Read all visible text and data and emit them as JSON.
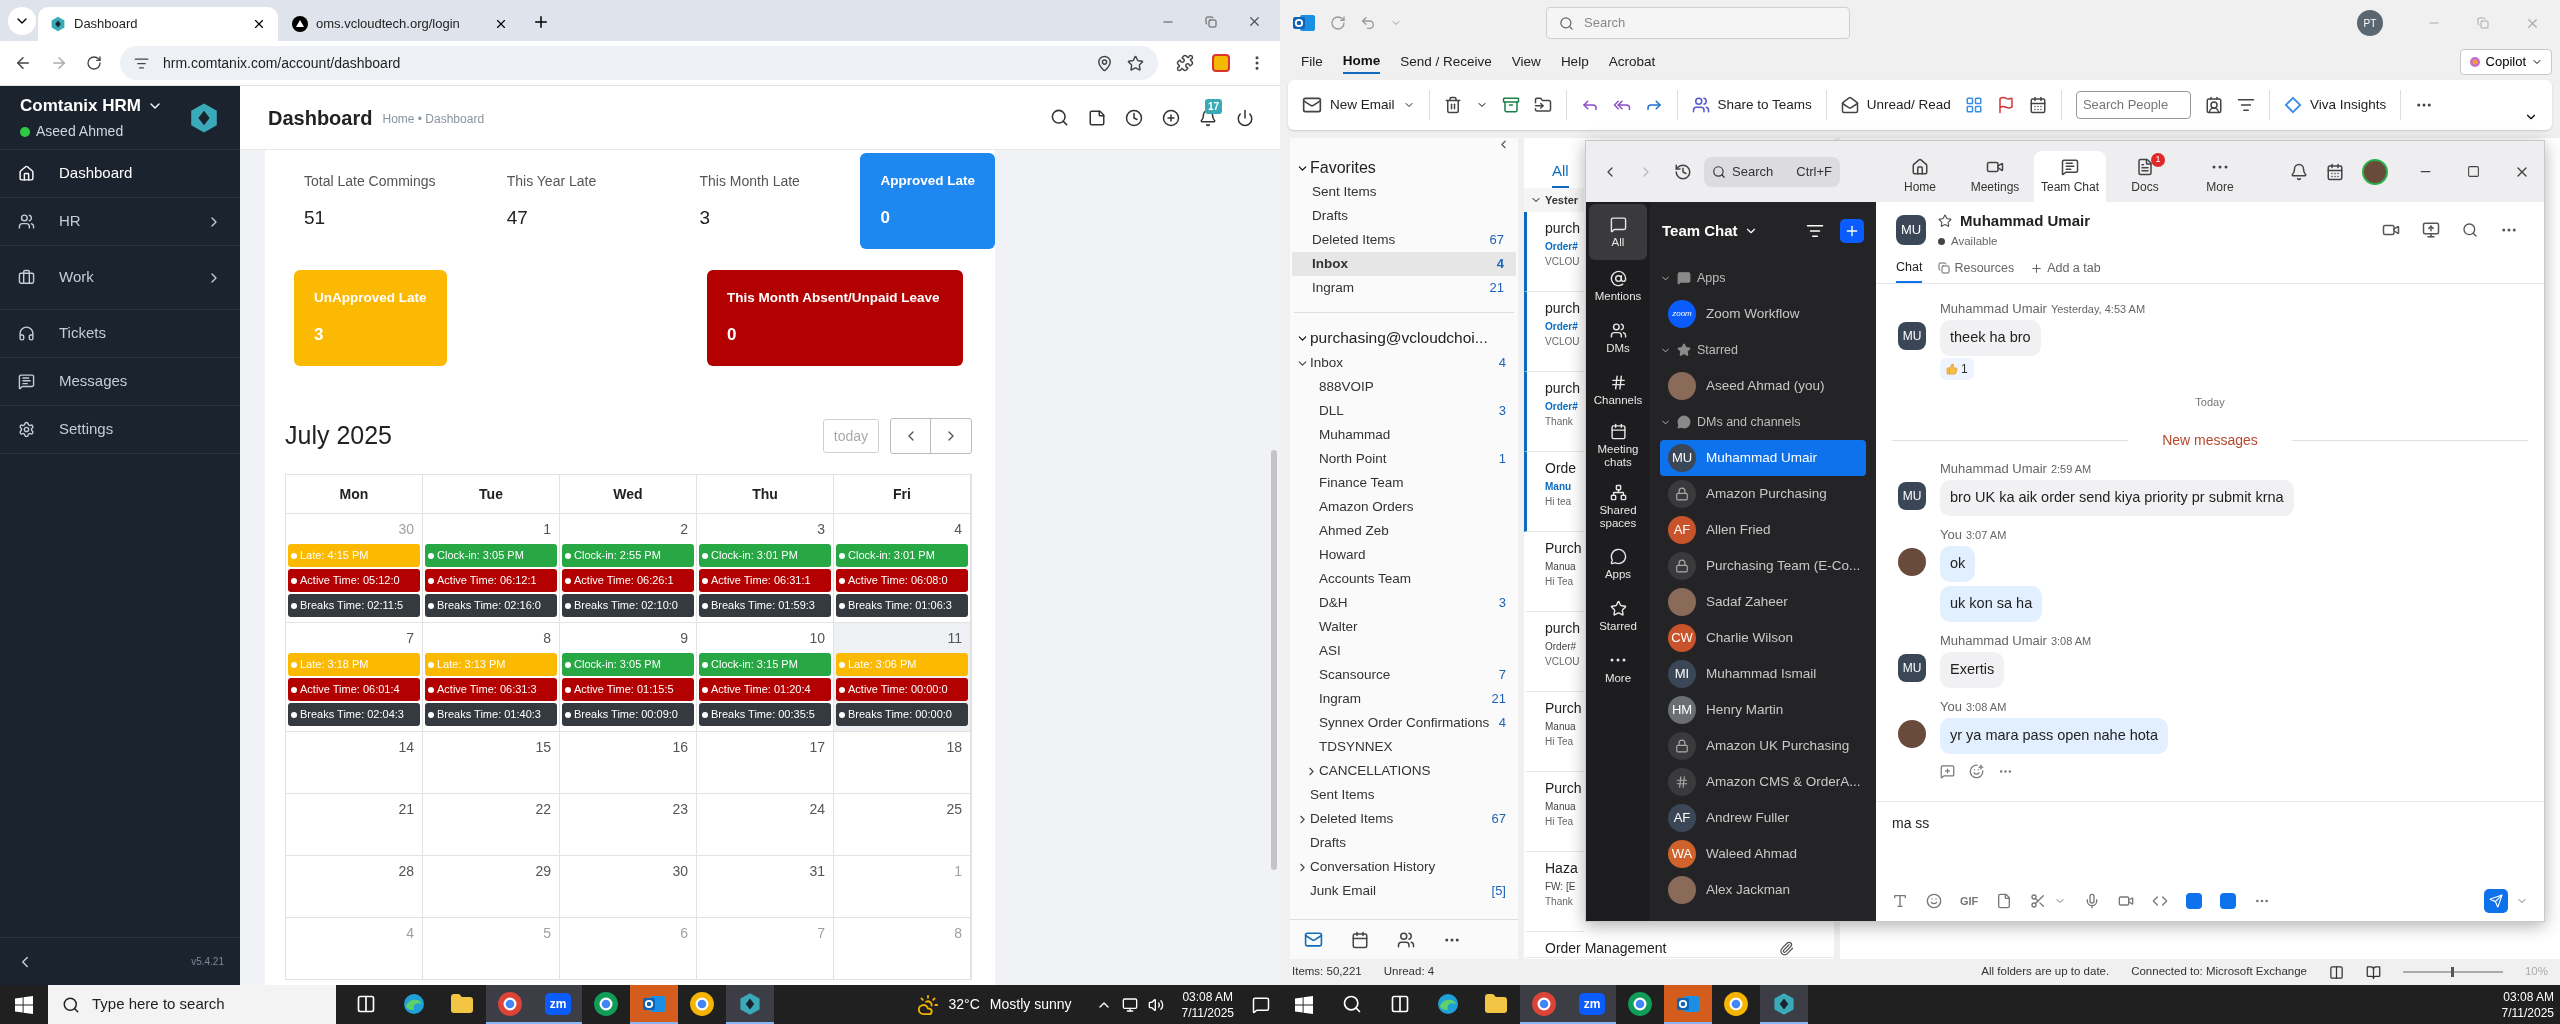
{
  "left_monitor": {
    "browser": {
      "tabs": [
        {
          "title": "Dashboard",
          "selected": true
        },
        {
          "title": "oms.vcloudtech.org/login",
          "selected": false
        }
      ],
      "url": "hrm.comtanix.com/account/dashboard"
    },
    "sidebar": {
      "app_name": "Comtanix HRM",
      "user": "Aseed Ahmed",
      "user_online": true,
      "items": [
        {
          "label": "Dashboard",
          "selected": true,
          "has_submenu": false
        },
        {
          "label": "HR",
          "selected": false,
          "has_submenu": true
        },
        {
          "label": "Work",
          "selected": false,
          "has_submenu": true
        },
        {
          "label": "Tickets",
          "selected": false,
          "has_submenu": false
        },
        {
          "label": "Messages",
          "selected": false,
          "has_submenu": false
        },
        {
          "label": "Settings",
          "selected": false,
          "has_submenu": false
        }
      ],
      "version": "v5.4.21"
    },
    "header": {
      "title": "Dashboard",
      "breadcrumb": "Home • Dashboard",
      "notification_count": "17"
    },
    "stats_rows": [
      [
        {
          "kind": "plain",
          "label": "Total Late Commings",
          "value": "51"
        },
        {
          "kind": "plain",
          "label": "This Year Late",
          "value": "47"
        },
        {
          "kind": "plain",
          "label": "This Month Late",
          "value": "3"
        },
        {
          "kind": "card",
          "label": "Approved Late",
          "value": "0",
          "color": "#1f87f0"
        }
      ],
      [
        {
          "kind": "card",
          "label": "UnApproved Late",
          "value": "3",
          "color": "#fbb902"
        },
        {
          "kind": "card",
          "label": "This Month Absent/Unpaid Leave",
          "value": "0",
          "color": "#b30000"
        }
      ]
    ],
    "calendar": {
      "title": "July 2025",
      "today_button": "today",
      "weekdays": [
        "Mon",
        "Tue",
        "Wed",
        "Thu",
        "Fri"
      ],
      "weeks": [
        {
          "days": [
            {
              "day": "30",
              "other_month": true,
              "today": false,
              "events": [
                {
                  "kind": "late",
                  "text": "Late: 4:15 PM"
                },
                {
                  "kind": "active",
                  "text": "Active Time: 05:12:0"
                },
                {
                  "kind": "breaks",
                  "text": "Breaks Time: 02:11:5"
                }
              ]
            },
            {
              "day": "1",
              "other_month": false,
              "today": false,
              "events": [
                {
                  "kind": "clockin",
                  "text": "Clock-in: 3:05 PM"
                },
                {
                  "kind": "active",
                  "text": "Active Time: 06:12:1"
                },
                {
                  "kind": "breaks",
                  "text": "Breaks Time: 02:16:0"
                }
              ]
            },
            {
              "day": "2",
              "other_month": false,
              "today": false,
              "events": [
                {
                  "kind": "clockin",
                  "text": "Clock-in: 2:55 PM"
                },
                {
                  "kind": "active",
                  "text": "Active Time: 06:26:1"
                },
                {
                  "kind": "breaks",
                  "text": "Breaks Time: 02:10:0"
                }
              ]
            },
            {
              "day": "3",
              "other_month": false,
              "today": false,
              "events": [
                {
                  "kind": "clockin",
                  "text": "Clock-in: 3:01 PM"
                },
                {
                  "kind": "active",
                  "text": "Active Time: 06:31:1"
                },
                {
                  "kind": "breaks",
                  "text": "Breaks Time: 01:59:3"
                }
              ]
            },
            {
              "day": "4",
              "other_month": false,
              "today": false,
              "events": [
                {
                  "kind": "clockin",
                  "text": "Clock-in: 3:01 PM"
                },
                {
                  "kind": "active",
                  "text": "Active Time: 06:08:0"
                },
                {
                  "kind": "breaks",
                  "text": "Breaks Time: 01:06:3"
                }
              ]
            }
          ]
        },
        {
          "days": [
            {
              "day": "7",
              "other_month": false,
              "today": false,
              "events": [
                {
                  "kind": "late",
                  "text": "Late: 3:18 PM"
                },
                {
                  "kind": "active",
                  "text": "Active Time: 06:01:4"
                },
                {
                  "kind": "breaks",
                  "text": "Breaks Time: 02:04:3"
                }
              ]
            },
            {
              "day": "8",
              "other_month": false,
              "today": false,
              "events": [
                {
                  "kind": "late",
                  "text": "Late: 3:13 PM"
                },
                {
                  "kind": "active",
                  "text": "Active Time: 06:31:3"
                },
                {
                  "kind": "breaks",
                  "text": "Breaks Time: 01:40:3"
                }
              ]
            },
            {
              "day": "9",
              "other_month": false,
              "today": false,
              "events": [
                {
                  "kind": "clockin",
                  "text": "Clock-in: 3:05 PM"
                },
                {
                  "kind": "active",
                  "text": "Active Time: 01:15:5"
                },
                {
                  "kind": "breaks",
                  "text": "Breaks Time: 00:09:0"
                }
              ]
            },
            {
              "day": "10",
              "other_month": false,
              "today": false,
              "events": [
                {
                  "kind": "clockin",
                  "text": "Clock-in: 3:15 PM"
                },
                {
                  "kind": "active",
                  "text": "Active Time: 01:20:4"
                },
                {
                  "kind": "breaks",
                  "text": "Breaks Time: 00:35:5"
                }
              ]
            },
            {
              "day": "11",
              "other_month": false,
              "today": true,
              "events": [
                {
                  "kind": "late",
                  "text": "Late: 3:06 PM"
                },
                {
                  "kind": "active",
                  "text": "Active Time: 00:00:0"
                },
                {
                  "kind": "breaks",
                  "text": "Breaks Time: 00:00:0"
                }
              ]
            }
          ]
        },
        {
          "days": [
            {
              "day": "14",
              "other_month": false,
              "today": false
            },
            {
              "day": "15",
              "other_month": false,
              "today": false
            },
            {
              "day": "16",
              "other_month": false,
              "today": false
            },
            {
              "day": "17",
              "other_month": false,
              "today": false
            },
            {
              "day": "18",
              "other_month": false,
              "today": false
            }
          ]
        },
        {
          "days": [
            {
              "day": "21",
              "other_month": false,
              "today": false
            },
            {
              "day": "22",
              "other_month": false,
              "today": false
            },
            {
              "day": "23",
              "other_month": false,
              "today": false
            },
            {
              "day": "24",
              "other_month": false,
              "today": false
            },
            {
              "day": "25",
              "other_month": false,
              "today": false
            }
          ]
        },
        {
          "days": [
            {
              "day": "28",
              "other_month": false,
              "today": false
            },
            {
              "day": "29",
              "other_month": false,
              "today": false
            },
            {
              "day": "30",
              "other_month": false,
              "today": false
            },
            {
              "day": "31",
              "other_month": false,
              "today": false
            },
            {
              "day": "1",
              "other_month": true,
              "today": false
            }
          ]
        },
        {
          "days": [
            {
              "day": "4",
              "other_month": true,
              "today": false
            },
            {
              "day": "5",
              "other_month": true,
              "today": false
            },
            {
              "day": "6",
              "other_month": true,
              "today": false
            },
            {
              "day": "7",
              "other_month": true,
              "today": false
            },
            {
              "day": "8",
              "other_month": true,
              "today": false
            }
          ]
        }
      ]
    },
    "taskbar": {
      "search_placeholder": "Type here to search",
      "zoom_icon_text": "zm",
      "temperature": "32°C",
      "weather": "Mostly sunny",
      "time": "03:08 AM",
      "date": "7/11/2025"
    }
  },
  "right_monitor": {
    "outlook": {
      "search_placeholder": "Search",
      "user_initials": "PT",
      "menu": [
        {
          "label": "File",
          "selected": false
        },
        {
          "label": "Home",
          "selected": true
        },
        {
          "label": "Send / Receive",
          "selected": false
        },
        {
          "label": "View",
          "selected": false
        },
        {
          "label": "Help",
          "selected": false
        },
        {
          "label": "Acrobat",
          "selected": false
        }
      ],
      "copilot": "Copilot",
      "ribbon": {
        "new_email": "New Email",
        "share_to_teams": "Share to Teams",
        "unread_read": "Unread/ Read",
        "search_people_placeholder": "Search People",
        "viva_insights": "Viva Insights"
      },
      "favorites": {
        "title": "Favorites",
        "expanded": true,
        "items": [
          {
            "label": "Sent Items",
            "selected": false
          },
          {
            "label": "Drafts",
            "selected": false
          },
          {
            "label": "Deleted Items",
            "count": "67",
            "selected": false
          },
          {
            "label": "Inbox",
            "count": "4",
            "selected": true
          },
          {
            "label": "Ingram",
            "count": "21",
            "selected": false
          }
        ]
      },
      "account": {
        "title": "purchasing@vcloudchoi...",
        "expanded": true,
        "folders": [
          {
            "label": "Inbox",
            "count": "4",
            "expanded": true,
            "children": [
              {
                "label": "888VOIP"
              },
              {
                "label": "DLL",
                "count": "3"
              },
              {
                "label": "Muhammad"
              },
              {
                "label": "North Point",
                "count": "1"
              },
              {
                "label": "Finance Team"
              },
              {
                "label": "Amazon Orders"
              },
              {
                "label": "Ahmed Zeb"
              },
              {
                "label": "Howard"
              },
              {
                "label": "Accounts Team"
              },
              {
                "label": "D&H",
                "count": "3"
              },
              {
                "label": "Walter"
              },
              {
                "label": "ASI"
              },
              {
                "label": "Scansource",
                "count": "7"
              },
              {
                "label": "Ingram",
                "count": "21"
              },
              {
                "label": "Synnex Order Confirmations",
                "count": "4"
              },
              {
                "label": "TDSYNNEX"
              },
              {
                "label": "CANCELLATIONS",
                "expanded": false
              }
            ]
          },
          {
            "label": "Sent Items"
          },
          {
            "label": "Deleted Items",
            "count": "67",
            "expanded": false
          },
          {
            "label": "Drafts"
          },
          {
            "label": "Conversation History",
            "expanded": false
          },
          {
            "label": "Junk Email",
            "count": "[5]"
          }
        ]
      },
      "message_list": {
        "filter_tab": "All",
        "group": "Yester",
        "messages": [
          {
            "sender": "purch",
            "subject": "Order#",
            "preview": "VCLOU",
            "unread": true,
            "has_attachment": false
          },
          {
            "sender": "purch",
            "subject": "Order#",
            "preview": "VCLOU",
            "unread": true,
            "has_attachment": false
          },
          {
            "sender": "purch",
            "subject": "Order#",
            "preview": "Thank",
            "unread": true,
            "has_attachment": false
          },
          {
            "sender": "Orde",
            "subject": "Manu",
            "preview": "Hi tea",
            "unread": true,
            "has_attachment": false
          },
          {
            "sender": "Purch",
            "subject": "Manua",
            "preview": "Hi Tea",
            "unread": false,
            "has_attachment": false
          },
          {
            "sender": "purch",
            "subject": "Order#",
            "preview": "VCLOU",
            "unread": false,
            "has_attachment": false
          },
          {
            "sender": "Purch",
            "subject": "Manua",
            "preview": "Hi Tea",
            "unread": false,
            "has_attachment": false
          },
          {
            "sender": "Purch",
            "subject": "Manua",
            "preview": "Hi Tea",
            "unread": false,
            "has_attachment": false
          },
          {
            "sender": "Haza",
            "subject": "FW: [E",
            "preview": "Thank",
            "unread": false,
            "has_attachment": false
          },
          {
            "sender": "Order Management",
            "unread": false,
            "has_attachment": true
          }
        ]
      },
      "status_bar": {
        "items": "Items: 50,221",
        "unread": "Unread: 4",
        "sync": "All folders are up to date.",
        "connection": "Connected to: Microsoft Exchange",
        "zoom_level": "10%",
        "zoom_slider": {
          "level": 0.5
        }
      }
    },
    "zoom": {
      "search": "Search",
      "search_shortcut": "Ctrl+F",
      "tabs": [
        {
          "label": "Home",
          "selected": false
        },
        {
          "label": "Meetings",
          "selected": false
        },
        {
          "label": "Team Chat",
          "selected": true
        },
        {
          "label": "Docs",
          "selected": false,
          "badge": "1"
        },
        {
          "label": "More",
          "selected": false
        }
      ],
      "nav": [
        {
          "label": "All",
          "selected": true
        },
        {
          "label": "Mentions",
          "selected": false
        },
        {
          "label": "DMs",
          "selected": false
        },
        {
          "label": "Channels",
          "selected": false
        },
        {
          "label": "Meeting chats",
          "selected": false
        },
        {
          "label": "Shared spaces",
          "selected": false
        },
        {
          "label": "Apps",
          "selected": false
        },
        {
          "label": "Starred",
          "selected": false
        },
        {
          "label": "More",
          "selected": false
        }
      ],
      "list_title": "Team Chat",
      "sections": [
        {
          "title": "Apps",
          "kind": "apps",
          "expanded": true,
          "items": [
            {
              "name": "Zoom Workflow",
              "kind": "app",
              "icon_text": "zoom",
              "selected": false
            }
          ]
        },
        {
          "title": "Starred",
          "kind": "starred",
          "expanded": true,
          "items": [
            {
              "name": "Aseed Ahmad (you)",
              "kind": "photo",
              "selected": false
            }
          ]
        },
        {
          "title": "DMs and channels",
          "kind": "dms",
          "expanded": true,
          "items": [
            {
              "name": "Muhammad Umair",
              "kind": "initials",
              "initials": "MU",
              "color": "#3b4756",
              "selected": true
            },
            {
              "name": "Amazon Purchasing",
              "kind": "private",
              "selected": false
            },
            {
              "name": "Allen Fried",
              "kind": "initials",
              "initials": "AF",
              "color": "#c9532a",
              "selected": false
            },
            {
              "name": "Purchasing Team (E-Co...",
              "kind": "private",
              "selected": false
            },
            {
              "name": "Sadaf Zaheer",
              "kind": "photo",
              "selected": false
            },
            {
              "name": "Charlie Wilson",
              "kind": "initials",
              "initials": "CW",
              "color": "#c9532a",
              "selected": false
            },
            {
              "name": "Muhammad Ismail",
              "kind": "initials",
              "initials": "MI",
              "color": "#3b4756",
              "selected": false
            },
            {
              "name": "Henry Martin",
              "kind": "initials",
              "initials": "HM",
              "color": "#6b6e73",
              "selected": false
            },
            {
              "name": "Amazon UK Purchasing",
              "kind": "private",
              "selected": false
            },
            {
              "name": "Amazon CMS & OrderA...",
              "kind": "public",
              "selected": false
            },
            {
              "name": "Andrew Fuller",
              "kind": "initials",
              "initials": "AF",
              "color": "#3b4756",
              "selected": false
            },
            {
              "name": "Waleed Ahmad",
              "kind": "initials",
              "initials": "WA",
              "color": "#d0622b",
              "selected": false
            },
            {
              "name": "Alex Jackman",
              "kind": "photo",
              "selected": false
            }
          ]
        }
      ],
      "chat": {
        "name": "Muhammad Umair",
        "initials": "MU",
        "status": "Available",
        "tabs": [
          {
            "label": "Chat",
            "selected": true
          },
          {
            "label": "Resources",
            "selected": false
          },
          {
            "label": "Add a tab",
            "selected": false
          }
        ],
        "messages": [
          {
            "kind": "group",
            "sender": "Muhammad Umair",
            "avatar_initials": "MU",
            "time": "Yesterday, 4:53 AM",
            "mine": false,
            "bubbles": [
              "theek ha bro"
            ],
            "reaction": "1",
            "actions": false
          },
          {
            "kind": "day",
            "text": "Today"
          },
          {
            "kind": "divider",
            "text": "New messages"
          },
          {
            "kind": "group",
            "sender": "Muhammad Umair",
            "avatar_initials": "MU",
            "time": "2:59 AM",
            "mine": false,
            "bubbles": [
              "bro UK ka aik order send kiya priority pr submit krna"
            ],
            "actions": false
          },
          {
            "kind": "group",
            "sender": "You",
            "time": "3:07 AM",
            "mine": true,
            "bubbles": [
              "ok",
              "uk kon sa ha"
            ],
            "actions": false
          },
          {
            "kind": "group",
            "sender": "Muhammad Umair",
            "avatar_initials": "MU",
            "time": "3:08 AM",
            "mine": false,
            "bubbles": [
              "Exertis"
            ],
            "actions": false
          },
          {
            "kind": "group",
            "sender": "You",
            "time": "3:08 AM",
            "mine": true,
            "bubbles": [
              "yr ya mara pass open nahe hota"
            ],
            "actions": true
          }
        ],
        "draft": "ma ss",
        "gif_label": "GIF"
      }
    },
    "taskbar": {
      "zoom_icon_text": "zm",
      "time": "03:08 AM",
      "date": "7/11/2025"
    }
  }
}
